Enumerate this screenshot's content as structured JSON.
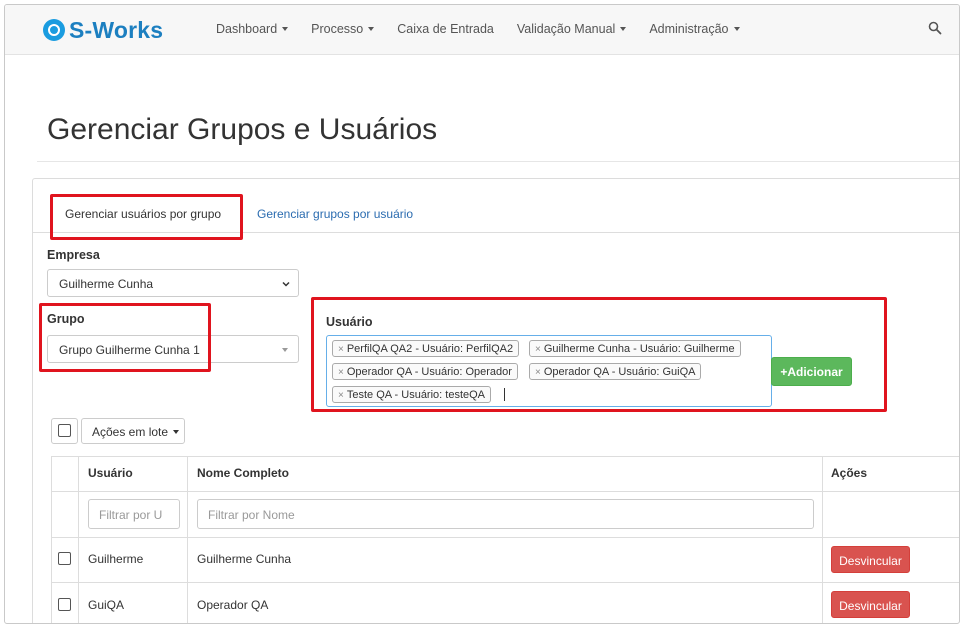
{
  "brand": {
    "name": "S-Works"
  },
  "nav": {
    "items": [
      {
        "label": "Dashboard",
        "dropdown": true
      },
      {
        "label": "Processo",
        "dropdown": true
      },
      {
        "label": "Caixa de Entrada",
        "dropdown": false
      },
      {
        "label": "Validação Manual",
        "dropdown": true
      },
      {
        "label": "Administração",
        "dropdown": true
      }
    ],
    "search_icon": "search-icon"
  },
  "page": {
    "title": "Gerenciar Grupos e Usuários"
  },
  "tabs": {
    "active": "Gerenciar usuários por grupo",
    "other": "Gerenciar grupos por usuário"
  },
  "form": {
    "empresa": {
      "label": "Empresa",
      "value": "Guilherme Cunha"
    },
    "grupo": {
      "label": "Grupo",
      "value": "Grupo Guilherme Cunha 1"
    },
    "usuario": {
      "label": "Usuário",
      "tags": [
        "PerfilQA QA2 - Usuário: PerfilQA2",
        "Guilherme Cunha - Usuário: Guilherme",
        "Operador QA - Usuário: Operador",
        "Operador QA - Usuário: GuiQA",
        "Teste QA - Usuário: testeQA"
      ],
      "tag_remove_glyph": "×"
    },
    "add_button": "+Adicionar"
  },
  "bulk": {
    "label": "Ações em lote"
  },
  "table": {
    "headers": {
      "usuario": "Usuário",
      "nome": "Nome Completo",
      "acoes": "Ações"
    },
    "filters": {
      "usuario_placeholder": "Filtrar por U",
      "nome_placeholder": "Filtrar por Nome"
    },
    "rows": [
      {
        "usuario": "Guilherme",
        "nome": "Guilherme Cunha",
        "action": "Desvincular"
      },
      {
        "usuario": "GuiQA",
        "nome": "Operador QA",
        "action": "Desvincular"
      }
    ]
  },
  "colors": {
    "brand": "#1c7fc0",
    "add": "#5cb85c",
    "unlink": "#d9534f",
    "highlight": "#e0141e",
    "link": "#2b6cb0"
  }
}
